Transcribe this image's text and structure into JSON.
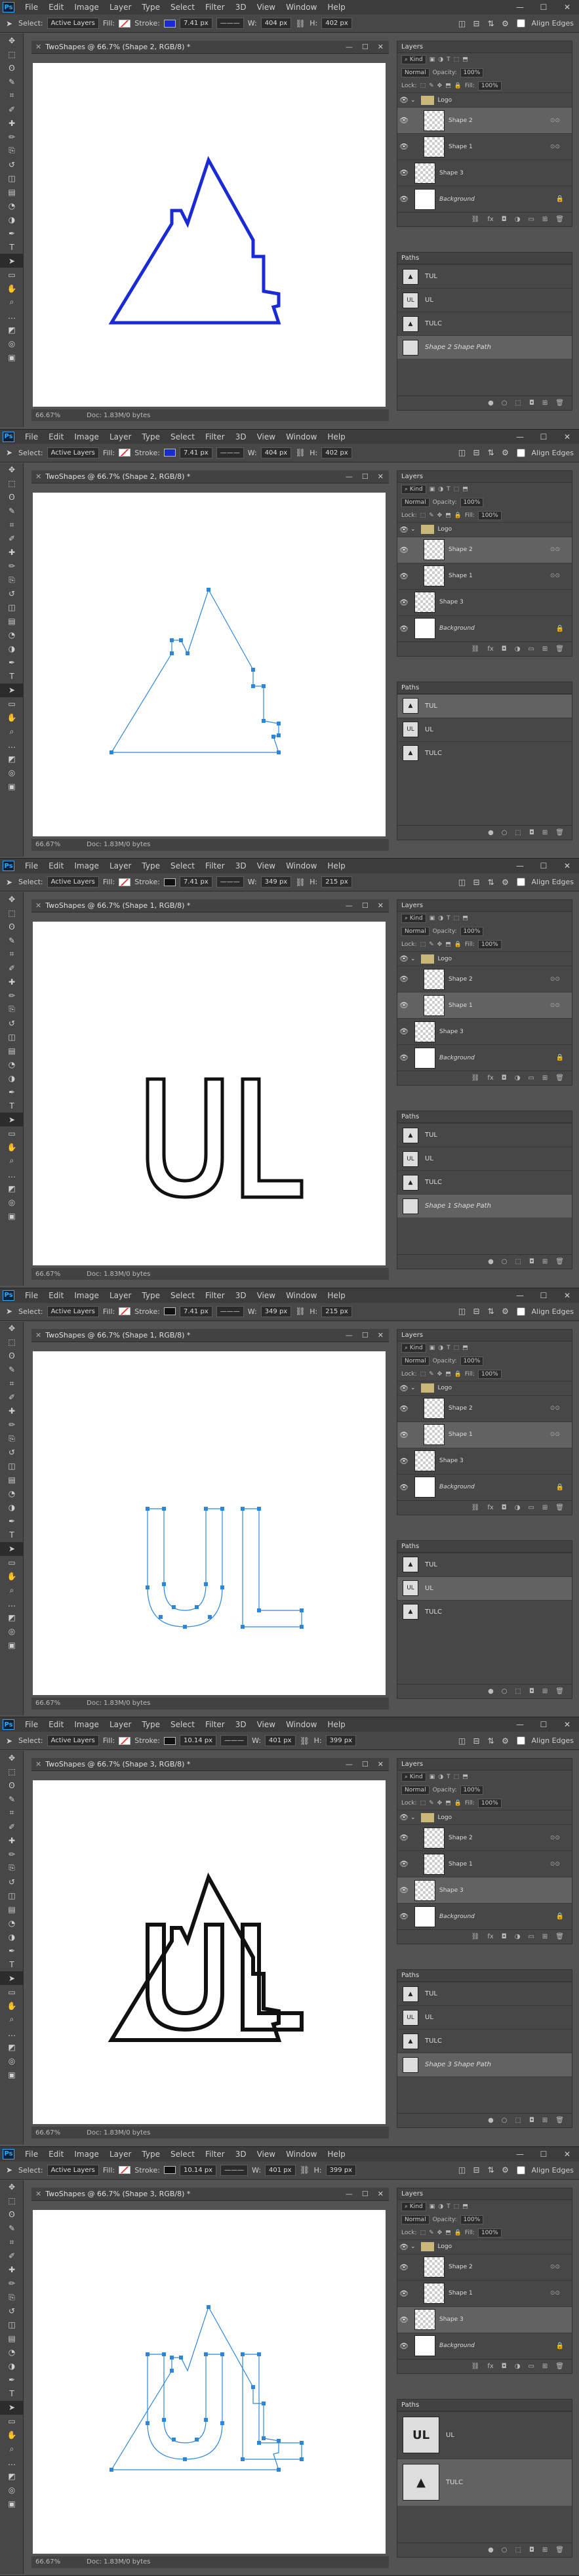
{
  "app": {
    "logo": "Ps",
    "menu": [
      "File",
      "Edit",
      "Image",
      "Layer",
      "Type",
      "Select",
      "Filter",
      "3D",
      "View",
      "Window",
      "Help"
    ],
    "window_controls": [
      "—",
      "☐",
      "✕"
    ]
  },
  "options": {
    "select_label": "Select:",
    "select_value": "Active Layers",
    "fill_label": "Fill:",
    "stroke_label": "Stroke:",
    "w_label": "W:",
    "h_label": "H:",
    "go_label": "GO",
    "align_edges": "Align Edges"
  },
  "tools": [
    "move-icon",
    "marquee-icon",
    "lasso-icon",
    "quick-select-icon",
    "crop-icon",
    "eyedropper-icon",
    "healing-icon",
    "brush-icon",
    "stamp-icon",
    "history-brush-icon",
    "eraser-icon",
    "gradient-icon",
    "blur-icon",
    "dodge-icon",
    "pen-icon",
    "type-icon",
    "path-select-icon",
    "shape-icon",
    "hand-icon",
    "zoom-icon",
    "more-icon",
    "fg-bg-icon",
    "quick-mask-icon",
    "screen-mode-icon"
  ],
  "tool_glyphs": [
    "✥",
    "⬚",
    "ʘ",
    "✎",
    "⌗",
    "✐",
    "✚",
    "✏",
    "⎘",
    "↺",
    "◫",
    "▤",
    "◔",
    "◑",
    "✒",
    "T",
    "➤",
    "▭",
    "✋",
    "⌕",
    "…",
    "◩",
    "◎",
    "▣"
  ],
  "layers_panel": {
    "title": "Layers",
    "kind": "Kind",
    "blend": "Normal",
    "opacity_label": "Opacity:",
    "opacity": "100%",
    "lock_label": "Lock:",
    "fill_label": "Fill:",
    "fill": "100%",
    "layer_names": {
      "logo": "Logo",
      "shape2": "Shape 2",
      "shape1": "Shape 1",
      "shape3": "Shape 3",
      "background": "Background"
    },
    "footer_icons": [
      "link-icon",
      "fx-icon",
      "mask-icon",
      "adjustment-icon",
      "group-icon",
      "new-layer-icon",
      "trash-icon"
    ],
    "footer_glyphs": [
      "⛓",
      "fx",
      "◘",
      "◑",
      "▭",
      "⊞",
      "🗑"
    ]
  },
  "paths_panel": {
    "title": "Paths",
    "paths": {
      "tul": "TUL",
      "ul": "UL",
      "tulc": "TULC",
      "shape2": "Shape 2 Shape Path",
      "shape1": "Shape 1 Shape Path",
      "shape3": "Shape 3 Shape Path"
    },
    "footer_glyphs": [
      "●",
      "○",
      "⬚",
      "◘",
      "⊞",
      "🗑"
    ]
  },
  "frames": [
    {
      "doc_title": "TwoShapes @ 66.7% (Shape 2, RGB/8) *",
      "stroke_swatch": "#1a2bd6",
      "stroke_width": "7.41 px",
      "w": "404 px",
      "h": "402 px",
      "zoom": "66.67%",
      "doc_info": "Doc: 1.83M/0 bytes",
      "shape": "triangle",
      "mode": "stroke",
      "color": "#1a2bd6",
      "layers": [
        {
          "key": "logo",
          "indent": 0,
          "folder": true,
          "selected": false
        },
        {
          "key": "shape2",
          "indent": 1,
          "folder": false,
          "selected": true
        },
        {
          "key": "shape1",
          "indent": 1,
          "folder": false,
          "selected": false
        },
        {
          "key": "shape3",
          "indent": 0,
          "folder": false,
          "selected": false
        },
        {
          "key": "background",
          "indent": 0,
          "folder": false,
          "selected": false,
          "lock": true
        }
      ],
      "paths": [
        {
          "key": "tul",
          "selected": false
        },
        {
          "key": "ul",
          "selected": false
        },
        {
          "key": "tulc",
          "selected": false
        },
        {
          "key": "shape2",
          "selected": true
        }
      ]
    },
    {
      "doc_title": "TwoShapes @ 66.7% (Shape 2, RGB/8) *",
      "stroke_swatch": "#1a2bd6",
      "stroke_width": "7.41 px",
      "w": "404 px",
      "h": "402 px",
      "zoom": "66.67%",
      "doc_info": "Doc: 1.83M/0 bytes",
      "shape": "triangle",
      "mode": "anchors",
      "color": "#2e86d8",
      "layers": [
        {
          "key": "logo",
          "indent": 0,
          "folder": true,
          "selected": false
        },
        {
          "key": "shape2",
          "indent": 1,
          "folder": false,
          "selected": true
        },
        {
          "key": "shape1",
          "indent": 1,
          "folder": false,
          "selected": false
        },
        {
          "key": "shape3",
          "indent": 0,
          "folder": false,
          "selected": false
        },
        {
          "key": "background",
          "indent": 0,
          "folder": false,
          "selected": false,
          "lock": true
        }
      ],
      "paths": [
        {
          "key": "tul",
          "selected": true
        },
        {
          "key": "ul",
          "selected": false
        },
        {
          "key": "tulc",
          "selected": false
        }
      ]
    },
    {
      "doc_title": "TwoShapes @ 66.7% (Shape 1, RGB/8) *",
      "stroke_swatch": "#111111",
      "stroke_width": "7.41 px",
      "w": "349 px",
      "h": "215 px",
      "zoom": "66.67%",
      "doc_info": "Doc: 1.83M/0 bytes",
      "shape": "ul",
      "mode": "stroke",
      "color": "#111111",
      "layers": [
        {
          "key": "logo",
          "indent": 0,
          "folder": true,
          "selected": false
        },
        {
          "key": "shape2",
          "indent": 1,
          "folder": false,
          "selected": false
        },
        {
          "key": "shape1",
          "indent": 1,
          "folder": false,
          "selected": true
        },
        {
          "key": "shape3",
          "indent": 0,
          "folder": false,
          "selected": false
        },
        {
          "key": "background",
          "indent": 0,
          "folder": false,
          "selected": false,
          "lock": true
        }
      ],
      "paths": [
        {
          "key": "tul",
          "selected": false
        },
        {
          "key": "ul",
          "selected": false
        },
        {
          "key": "tulc",
          "selected": false
        },
        {
          "key": "shape1",
          "selected": true
        }
      ]
    },
    {
      "doc_title": "TwoShapes @ 66.7% (Shape 1, RGB/8) *",
      "stroke_swatch": "#111111",
      "stroke_width": "7.41 px",
      "w": "349 px",
      "h": "215 px",
      "zoom": "66.67%",
      "doc_info": "Doc: 1.83M/0 bytes",
      "shape": "ul",
      "mode": "anchors",
      "color": "#2e86d8",
      "layers": [
        {
          "key": "logo",
          "indent": 0,
          "folder": true,
          "selected": false
        },
        {
          "key": "shape2",
          "indent": 1,
          "folder": false,
          "selected": false
        },
        {
          "key": "shape1",
          "indent": 1,
          "folder": false,
          "selected": true
        },
        {
          "key": "shape3",
          "indent": 0,
          "folder": false,
          "selected": false
        },
        {
          "key": "background",
          "indent": 0,
          "folder": false,
          "selected": false,
          "lock": true
        }
      ],
      "paths": [
        {
          "key": "tul",
          "selected": false
        },
        {
          "key": "ul",
          "selected": true
        },
        {
          "key": "tulc",
          "selected": false
        }
      ]
    },
    {
      "doc_title": "TwoShapes @ 66.7% (Shape 3, RGB/8) *",
      "stroke_swatch": "#111111",
      "stroke_width": "10.14 px",
      "w": "401 px",
      "h": "399 px",
      "zoom": "66.67%",
      "doc_info": "Doc: 1.83M/0 bytes",
      "shape": "tulc",
      "mode": "stroke",
      "color": "#111111",
      "layers": [
        {
          "key": "logo",
          "indent": 0,
          "folder": true,
          "selected": false
        },
        {
          "key": "shape2",
          "indent": 1,
          "folder": false,
          "selected": false
        },
        {
          "key": "shape1",
          "indent": 1,
          "folder": false,
          "selected": false
        },
        {
          "key": "shape3",
          "indent": 0,
          "folder": false,
          "selected": true
        },
        {
          "key": "background",
          "indent": 0,
          "folder": false,
          "selected": false,
          "lock": true
        }
      ],
      "paths": [
        {
          "key": "tul",
          "selected": false
        },
        {
          "key": "ul",
          "selected": false
        },
        {
          "key": "tulc",
          "selected": false
        },
        {
          "key": "shape3",
          "selected": true
        }
      ]
    },
    {
      "doc_title": "TwoShapes @ 66.7% (Shape 3, RGB/8) *",
      "stroke_swatch": "#111111",
      "stroke_width": "10.14 px",
      "w": "401 px",
      "h": "399 px",
      "zoom": "66.67%",
      "doc_info": "Doc: 1.83M/0 bytes",
      "shape": "tulc",
      "mode": "anchors",
      "color": "#2e86d8",
      "layers": [
        {
          "key": "logo",
          "indent": 0,
          "folder": true,
          "selected": false
        },
        {
          "key": "shape2",
          "indent": 1,
          "folder": false,
          "selected": false
        },
        {
          "key": "shape1",
          "indent": 1,
          "folder": false,
          "selected": false
        },
        {
          "key": "shape3",
          "indent": 0,
          "folder": false,
          "selected": true
        },
        {
          "key": "background",
          "indent": 0,
          "folder": false,
          "selected": false,
          "lock": true
        }
      ],
      "paths": [
        {
          "key": "ul",
          "selected": false,
          "big": true
        },
        {
          "key": "tulc",
          "selected": true,
          "big": true
        }
      ]
    }
  ]
}
